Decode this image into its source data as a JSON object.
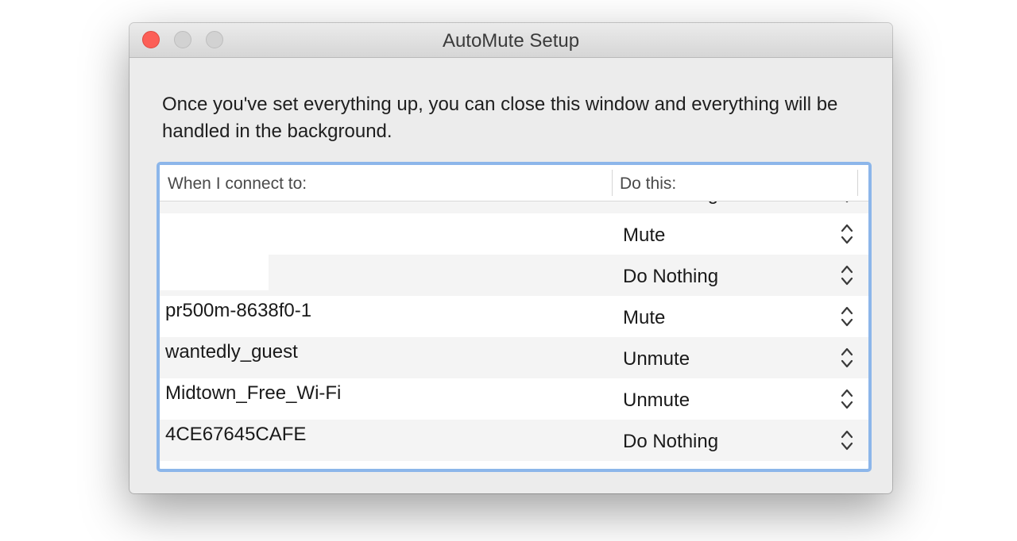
{
  "window": {
    "title": "AutoMute Setup"
  },
  "description": "Once you've set everything up, you can close this window and everything will be handled in the background.",
  "table": {
    "columns": {
      "connect": "When I connect to:",
      "action": "Do this:"
    },
    "rows": [
      {
        "network": "",
        "action": "Do Nothing"
      },
      {
        "network": "",
        "action": "Mute"
      },
      {
        "network": "",
        "action": "Do Nothing"
      },
      {
        "network": "pr500m-8638f0-1",
        "action": "Mute"
      },
      {
        "network": "wantedly_guest",
        "action": "Unmute"
      },
      {
        "network": "Midtown_Free_Wi-Fi",
        "action": "Unmute"
      },
      {
        "network": "4CE67645CAFE",
        "action": "Do Nothing"
      }
    ]
  },
  "icons": {
    "stepper": "chevron-up-down-icon"
  },
  "colors": {
    "close_button": "#fc5f57",
    "table_focus_ring": "#8cb6ea",
    "row_alternate": "#f4f4f4"
  }
}
